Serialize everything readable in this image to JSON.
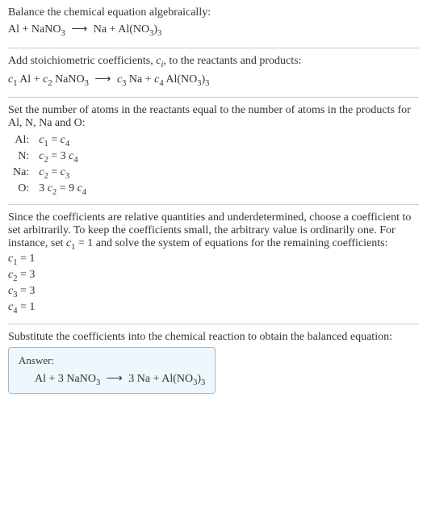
{
  "section1": {
    "intro": "Balance the chemical equation algebraically:",
    "equation_html": "Al + NaNO<sub>3</sub> <span class='arrow'>⟶</span> Na + Al(NO<sub>3</sub>)<sub>3</sub>"
  },
  "section2": {
    "intro_html": "Add stoichiometric coefficients, <span class='italic'>c<sub>i</sub></span>, to the reactants and products:",
    "equation_html": "<span class='italic'>c</span><sub>1</sub> Al + <span class='italic'>c</span><sub>2</sub> NaNO<sub>3</sub> <span class='arrow'>⟶</span> <span class='italic'>c</span><sub>3</sub> Na + <span class='italic'>c</span><sub>4</sub> Al(NO<sub>3</sub>)<sub>3</sub>"
  },
  "section3": {
    "intro": "Set the number of atoms in the reactants equal to the number of atoms in the products for Al, N, Na and O:",
    "rows": [
      {
        "el": "Al:",
        "eq_html": "<span class='italic'>c</span><sub>1</sub> = <span class='italic'>c</span><sub>4</sub>"
      },
      {
        "el": "N:",
        "eq_html": "<span class='italic'>c</span><sub>2</sub> = 3 <span class='italic'>c</span><sub>4</sub>"
      },
      {
        "el": "Na:",
        "eq_html": "<span class='italic'>c</span><sub>2</sub> = <span class='italic'>c</span><sub>3</sub>"
      },
      {
        "el": "O:",
        "eq_html": "3 <span class='italic'>c</span><sub>2</sub> = 9 <span class='italic'>c</span><sub>4</sub>"
      }
    ]
  },
  "section4": {
    "intro_html": "Since the coefficients are relative quantities and underdetermined, choose a coefficient to set arbitrarily. To keep the coefficients small, the arbitrary value is ordinarily one. For instance, set <span class='italic'>c</span><sub>1</sub> = 1 and solve the system of equations for the remaining coefficients:",
    "coeffs": [
      "<span class='italic'>c</span><sub>1</sub> = 1",
      "<span class='italic'>c</span><sub>2</sub> = 3",
      "<span class='italic'>c</span><sub>3</sub> = 3",
      "<span class='italic'>c</span><sub>4</sub> = 1"
    ]
  },
  "section5": {
    "intro": "Substitute the coefficients into the chemical reaction to obtain the balanced equation:",
    "answer_label": "Answer:",
    "answer_eq_html": "Al + 3 NaNO<sub>3</sub> <span class='arrow'>⟶</span> 3 Na + Al(NO<sub>3</sub>)<sub>3</sub>"
  },
  "chart_data": {
    "type": "table",
    "title": "Balancing Al + NaNO3 -> Na + Al(NO3)3",
    "atom_balance": [
      {
        "element": "Al",
        "equation": "c1 = c4"
      },
      {
        "element": "N",
        "equation": "c2 = 3 c4"
      },
      {
        "element": "Na",
        "equation": "c2 = c3"
      },
      {
        "element": "O",
        "equation": "3 c2 = 9 c4"
      }
    ],
    "solution": {
      "c1": 1,
      "c2": 3,
      "c3": 3,
      "c4": 1
    },
    "balanced_equation": "Al + 3 NaNO3 -> 3 Na + Al(NO3)3"
  }
}
